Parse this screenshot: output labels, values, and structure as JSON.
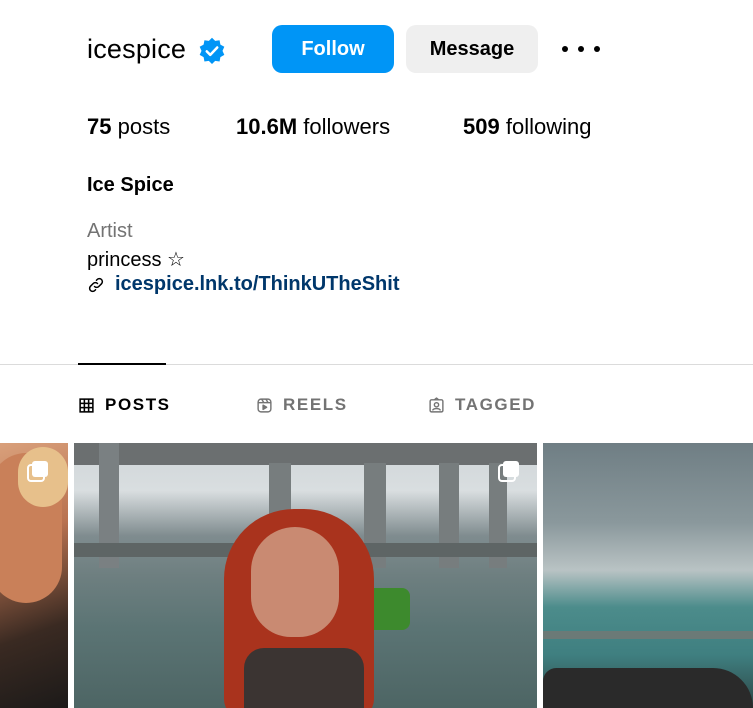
{
  "profile": {
    "username": "icespice",
    "full_name": "Ice Spice",
    "category": "Artist",
    "bio": "princess ☆",
    "link": "icespice.lnk.to/ThinkUTheShit",
    "verified_icon": "verified-badge-icon"
  },
  "actions": {
    "follow_label": "Follow",
    "message_label": "Message",
    "more_icon": "more-options-icon"
  },
  "stats": {
    "posts_count": "75",
    "posts_label": "posts",
    "followers_count": "10.6M",
    "followers_label": "followers",
    "following_count": "509",
    "following_label": "following"
  },
  "tabs": [
    {
      "label": "POSTS",
      "icon": "grid-icon",
      "active": true
    },
    {
      "label": "REELS",
      "icon": "reels-icon",
      "active": false
    },
    {
      "label": "TAGGED",
      "icon": "tagged-icon",
      "active": false
    }
  ],
  "colors": {
    "accent": "#0095f6",
    "link": "#00376b",
    "muted": "#737373",
    "divider": "#dbdbdb",
    "secondary_button": "#efefef"
  }
}
